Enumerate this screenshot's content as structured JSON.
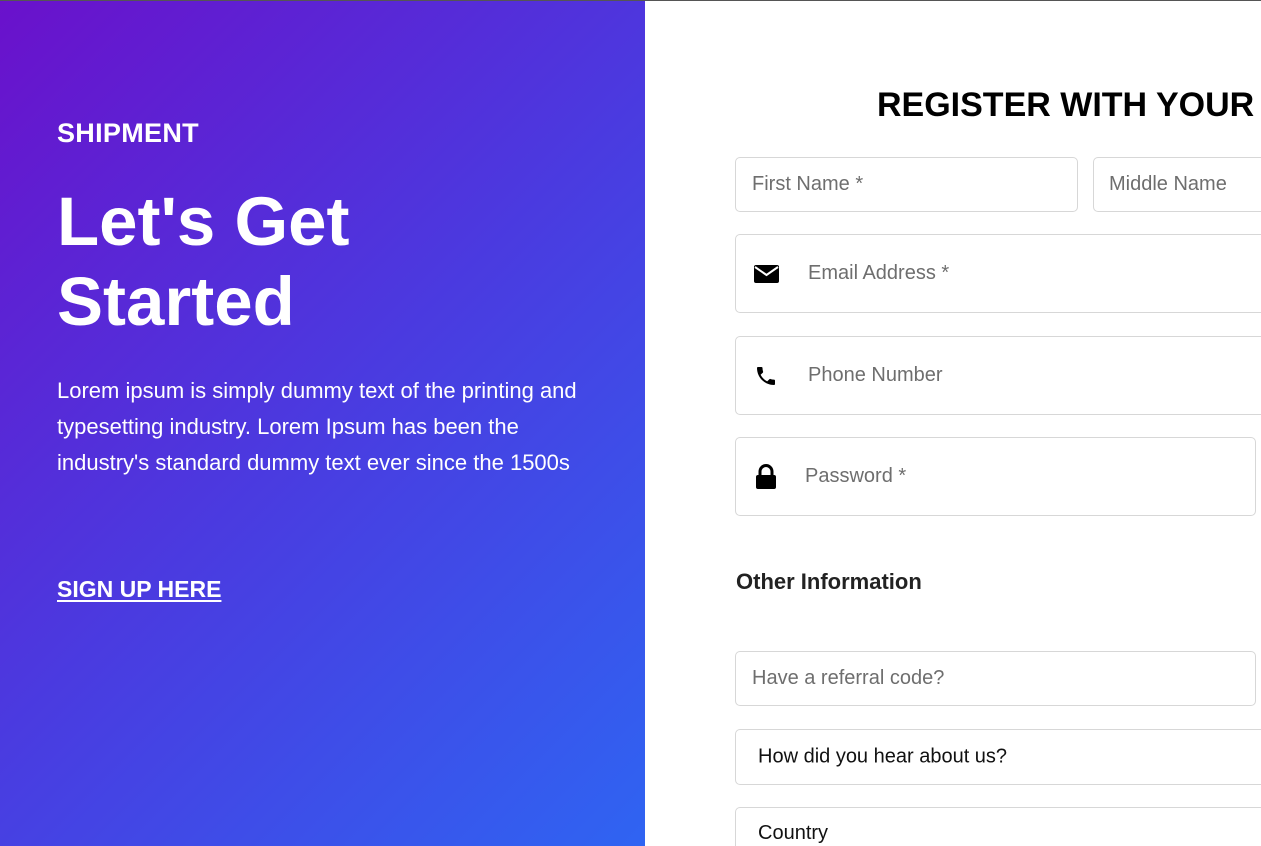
{
  "hero": {
    "eyebrow": "SHIPMENT",
    "title": "Let's Get Started",
    "description": "Lorem ipsum is simply dummy text of the printing and typesetting industry. Lorem Ipsum has been the industry's standard dummy text ever since the 1500s",
    "cta": "SIGN UP HERE",
    "gradient_start": "#6a11cb",
    "gradient_end": "#2f64f2"
  },
  "form": {
    "title": "REGISTER WITH YOUR W",
    "first_name_placeholder": "First Name *",
    "middle_name_placeholder": "Middle Name",
    "email_placeholder": "Email Address *",
    "phone_placeholder": "Phone Number",
    "password_placeholder": "Password *",
    "other_info_label": "Other Information",
    "referral_placeholder": "Have a referral code?",
    "hear_about_select": "How did you hear about us?",
    "country_select": "Country",
    "icons": {
      "email": "envelope-icon",
      "phone": "phone-icon",
      "password": "lock-icon"
    }
  }
}
